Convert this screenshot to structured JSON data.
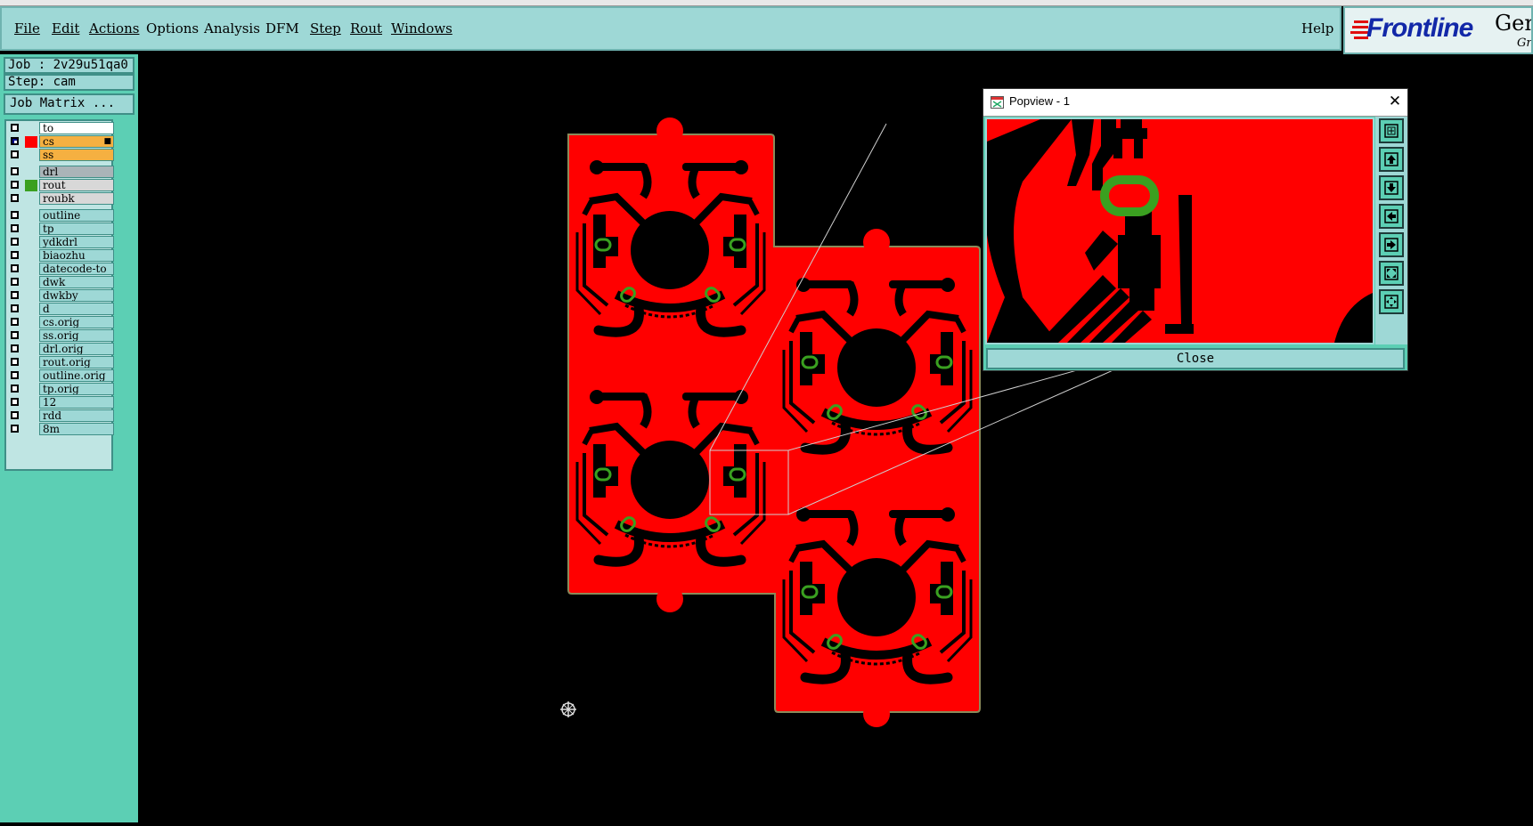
{
  "menu": {
    "file": "File",
    "edit": "Edit",
    "actions": "Actions",
    "options": "Options",
    "analysis": "Analysis",
    "dfm": "DFM",
    "step": "Step",
    "rout": "Rout",
    "windows": "Windows",
    "help": "Help"
  },
  "logo": {
    "name": "Frontline",
    "product": "Gen",
    "sub": "Gra"
  },
  "job": {
    "job_label": "Job : 2v29u51qa0",
    "step_label": "Step: cam",
    "matrix_button": "Job Matrix ..."
  },
  "layers": [
    {
      "name": "to",
      "checked": false,
      "color": "",
      "bg": "#ffffff"
    },
    {
      "name": "cs",
      "checked": true,
      "color": "#ff0000",
      "bg": "#f5b041",
      "marker": "■"
    },
    {
      "name": "ss",
      "checked": false,
      "color": "",
      "bg": "#f5b041"
    },
    {
      "name": "drl",
      "checked": false,
      "color": "",
      "bg": "#aab4b8"
    },
    {
      "name": "rout",
      "checked": false,
      "color": "#3aa020",
      "bg": "#d8d8d8"
    },
    {
      "name": "roubk",
      "checked": false,
      "color": "",
      "bg": "#d8d8d8"
    },
    {
      "name": "outline",
      "checked": false,
      "color": "",
      "bg": "#9ed8d6"
    },
    {
      "name": "tp",
      "checked": false,
      "color": "",
      "bg": "#9ed8d6"
    },
    {
      "name": "ydkdrl",
      "checked": false,
      "color": "",
      "bg": "#9ed8d6"
    },
    {
      "name": "biaozhu",
      "checked": false,
      "color": "",
      "bg": "#9ed8d6"
    },
    {
      "name": "datecode-to",
      "checked": false,
      "color": "",
      "bg": "#9ed8d6"
    },
    {
      "name": "dwk",
      "checked": false,
      "color": "",
      "bg": "#9ed8d6"
    },
    {
      "name": "dwkby",
      "checked": false,
      "color": "",
      "bg": "#9ed8d6"
    },
    {
      "name": "d",
      "checked": false,
      "color": "",
      "bg": "#9ed8d6"
    },
    {
      "name": "cs.orig",
      "checked": false,
      "color": "",
      "bg": "#9ed8d6"
    },
    {
      "name": "ss.orig",
      "checked": false,
      "color": "",
      "bg": "#9ed8d6"
    },
    {
      "name": "drl.orig",
      "checked": false,
      "color": "",
      "bg": "#9ed8d6"
    },
    {
      "name": "rout.orig",
      "checked": false,
      "color": "",
      "bg": "#9ed8d6"
    },
    {
      "name": "outline.orig",
      "checked": false,
      "color": "",
      "bg": "#9ed8d6"
    },
    {
      "name": "tp.orig",
      "checked": false,
      "color": "",
      "bg": "#9ed8d6"
    },
    {
      "name": "12",
      "checked": false,
      "color": "",
      "bg": "#9ed8d6"
    },
    {
      "name": "rdd",
      "checked": false,
      "color": "",
      "bg": "#9ed8d6"
    },
    {
      "name": "8m",
      "checked": false,
      "color": "",
      "bg": "#9ed8d6"
    }
  ],
  "popview": {
    "title": "Popview - 1",
    "close_label": "Close",
    "tools": [
      "zoom-in-icon",
      "pan-up-icon",
      "pan-down-icon",
      "pan-left-icon",
      "pan-right-icon",
      "zoom-fit-icon",
      "zoom-out-icon"
    ]
  },
  "colors": {
    "copper": "#ff0000",
    "rout": "#3aa020",
    "board_edge": "#8a8a5a",
    "background": "#000000",
    "panel": "#9ed8d6",
    "sidebar": "#5ccfb4"
  }
}
